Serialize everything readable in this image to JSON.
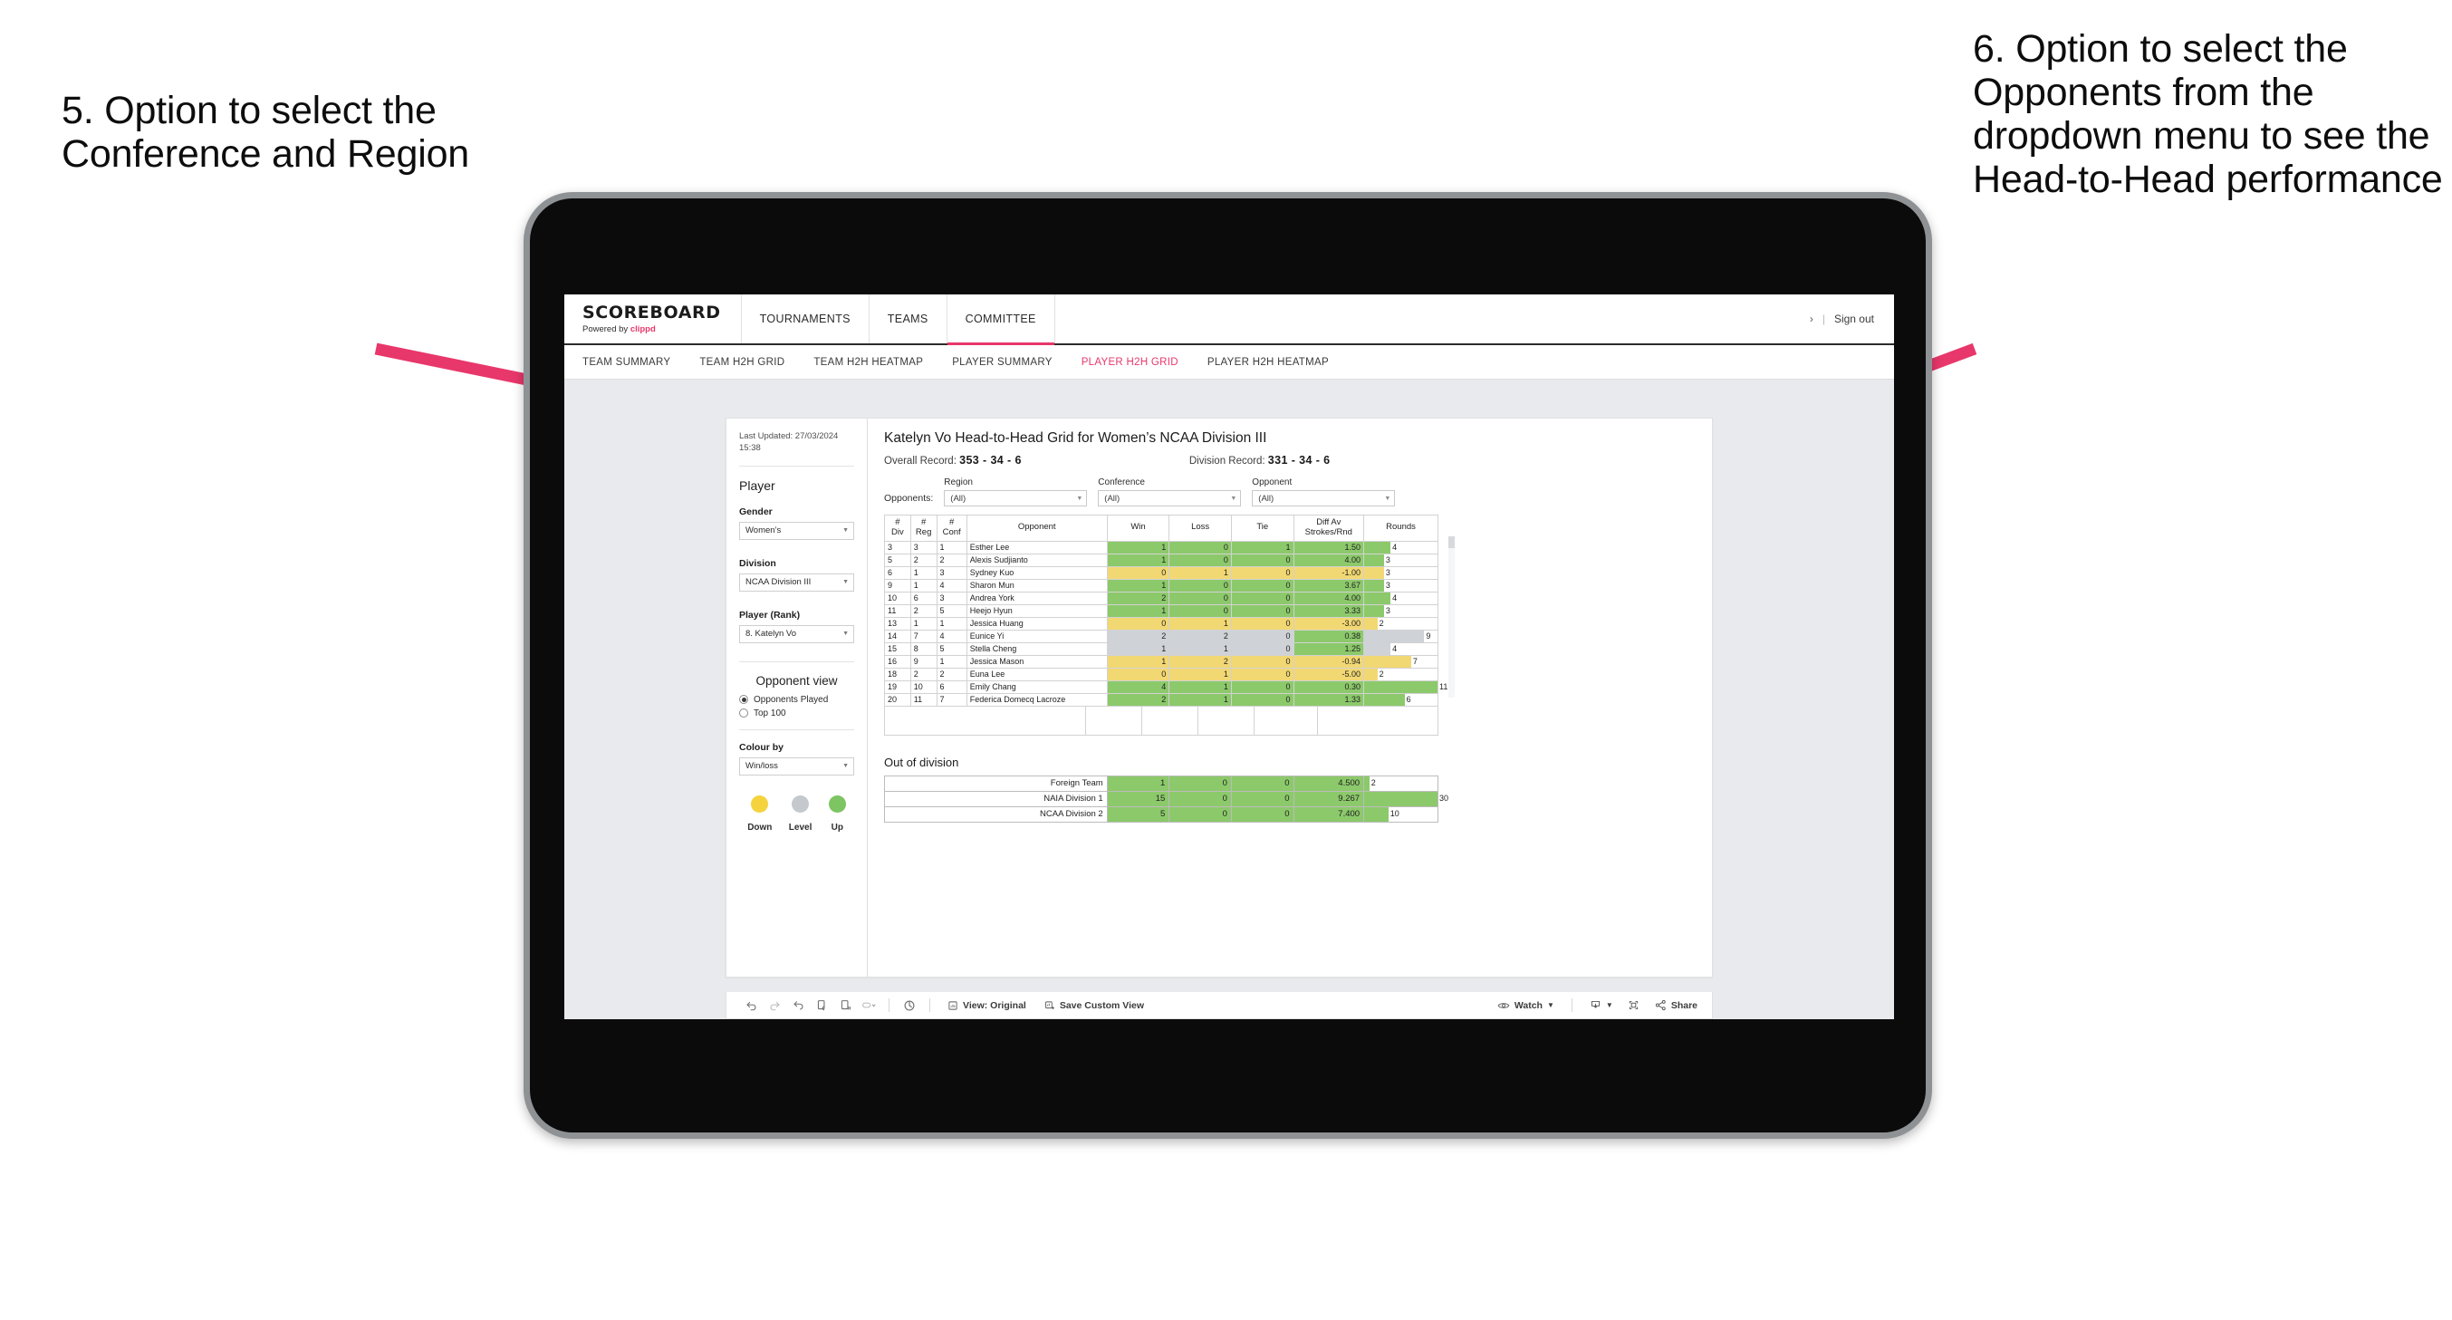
{
  "annotations": {
    "left": "5. Option to select the Conference and Region",
    "right": "6. Option to select the Opponents from the dropdown menu to see the Head-to-Head performance",
    "arrow_color": "#E8376B"
  },
  "app": {
    "brand": {
      "title": "SCOREBOARD",
      "powered_prefix": "Powered by ",
      "powered_brand": "clippd"
    },
    "topnav": [
      {
        "label": "TOURNAMENTS",
        "active": false
      },
      {
        "label": "TEAMS",
        "active": false
      },
      {
        "label": "COMMITTEE",
        "active": true
      }
    ],
    "topbar_right": {
      "chevron": "›",
      "separator": "|",
      "signout": "Sign out"
    },
    "subnav": [
      {
        "label": "TEAM SUMMARY",
        "active": false
      },
      {
        "label": "TEAM H2H GRID",
        "active": false
      },
      {
        "label": "TEAM H2H HEATMAP",
        "active": false
      },
      {
        "label": "PLAYER SUMMARY",
        "active": false
      },
      {
        "label": "PLAYER H2H GRID",
        "active": true
      },
      {
        "label": "PLAYER H2H HEATMAP",
        "active": false
      }
    ]
  },
  "sidebar": {
    "last_updated": "Last Updated: 27/03/2024 15:38",
    "player_heading": "Player",
    "gender": {
      "label": "Gender",
      "value": "Women’s"
    },
    "division": {
      "label": "Division",
      "value": "NCAA Division III"
    },
    "player_rank": {
      "label": "Player (Rank)",
      "value": "8. Katelyn Vo"
    },
    "opponent_view": {
      "heading": "Opponent view",
      "options": [
        {
          "label": "Opponents Played",
          "selected": true
        },
        {
          "label": "Top 100",
          "selected": false
        }
      ]
    },
    "colour_by": {
      "label": "Colour by",
      "value": "Win/loss"
    },
    "legend": [
      {
        "label": "Down",
        "color": "#F5D33F"
      },
      {
        "label": "Level",
        "color": "#C5C9CE"
      },
      {
        "label": "Up",
        "color": "#7DC462"
      }
    ]
  },
  "main": {
    "title": "Katelyn Vo Head-to-Head Grid for Women’s NCAA Division III",
    "overall_record": {
      "label": "Overall Record:",
      "value": "353 -  34 - 6"
    },
    "division_record": {
      "label": "Division Record:",
      "value": "331 -  34 - 6"
    },
    "filters": {
      "prefix": "Opponents:",
      "items": [
        {
          "label": "Region",
          "value": "(All)"
        },
        {
          "label": "Conference",
          "value": "(All)"
        },
        {
          "label": "Opponent",
          "value": "(All)"
        }
      ]
    },
    "table": {
      "headers": [
        "# Div",
        "# Reg",
        "# Conf",
        "Opponent",
        "Win",
        "Loss",
        "Tie",
        "Diff Av Strokes/Rnd",
        "Rounds"
      ],
      "header_lines": [
        [
          "#",
          "Div"
        ],
        [
          "#",
          "Reg"
        ],
        [
          "#",
          "Conf"
        ],
        [
          "Opponent"
        ],
        [
          "Win"
        ],
        [
          "Loss"
        ],
        [
          "Tie"
        ],
        [
          "Diff Av",
          "Strokes/Rnd"
        ],
        [
          "Rounds"
        ]
      ],
      "rounds_max": 11,
      "rows": [
        {
          "div": "3",
          "reg": "3",
          "conf": "1",
          "opponent": "Esther Lee",
          "win": "1",
          "loss": "0",
          "tie": "1",
          "diff": "1.50",
          "rounds": "4",
          "color": "green"
        },
        {
          "div": "5",
          "reg": "2",
          "conf": "2",
          "opponent": "Alexis Sudjianto",
          "win": "1",
          "loss": "0",
          "tie": "0",
          "diff": "4.00",
          "rounds": "3",
          "color": "green"
        },
        {
          "div": "6",
          "reg": "1",
          "conf": "3",
          "opponent": "Sydney Kuo",
          "win": "0",
          "loss": "1",
          "tie": "0",
          "diff": "-1.00",
          "rounds": "3",
          "color": "yellow"
        },
        {
          "div": "9",
          "reg": "1",
          "conf": "4",
          "opponent": "Sharon Mun",
          "win": "1",
          "loss": "0",
          "tie": "0",
          "diff": "3.67",
          "rounds": "3",
          "color": "green"
        },
        {
          "div": "10",
          "reg": "6",
          "conf": "3",
          "opponent": "Andrea York",
          "win": "2",
          "loss": "0",
          "tie": "0",
          "diff": "4.00",
          "rounds": "4",
          "color": "green"
        },
        {
          "div": "11",
          "reg": "2",
          "conf": "5",
          "opponent": "Heejo Hyun",
          "win": "1",
          "loss": "0",
          "tie": "0",
          "diff": "3.33",
          "rounds": "3",
          "color": "green"
        },
        {
          "div": "13",
          "reg": "1",
          "conf": "1",
          "opponent": "Jessica Huang",
          "win": "0",
          "loss": "1",
          "tie": "0",
          "diff": "-3.00",
          "rounds": "2",
          "color": "yellow"
        },
        {
          "div": "14",
          "reg": "7",
          "conf": "4",
          "opponent": "Eunice Yi",
          "win": "2",
          "loss": "2",
          "tie": "0",
          "diff": "0.38",
          "rounds": "9",
          "color": "grey",
          "diff_color": "green"
        },
        {
          "div": "15",
          "reg": "8",
          "conf": "5",
          "opponent": "Stella Cheng",
          "win": "1",
          "loss": "1",
          "tie": "0",
          "diff": "1.25",
          "rounds": "4",
          "color": "grey",
          "diff_color": "green"
        },
        {
          "div": "16",
          "reg": "9",
          "conf": "1",
          "opponent": "Jessica Mason",
          "win": "1",
          "loss": "2",
          "tie": "0",
          "diff": "-0.94",
          "rounds": "7",
          "color": "yellow"
        },
        {
          "div": "18",
          "reg": "2",
          "conf": "2",
          "opponent": "Euna Lee",
          "win": "0",
          "loss": "1",
          "tie": "0",
          "diff": "-5.00",
          "rounds": "2",
          "color": "yellow"
        },
        {
          "div": "19",
          "reg": "10",
          "conf": "6",
          "opponent": "Emily Chang",
          "win": "4",
          "loss": "1",
          "tie": "0",
          "diff": "0.30",
          "rounds": "11",
          "color": "green"
        },
        {
          "div": "20",
          "reg": "11",
          "conf": "7",
          "opponent": "Federica Domecq Lacroze",
          "win": "2",
          "loss": "1",
          "tie": "0",
          "diff": "1.33",
          "rounds": "6",
          "color": "green"
        }
      ]
    },
    "out_of_division": {
      "title": "Out of division",
      "rounds_max": 30,
      "rows": [
        {
          "name": "Foreign Team",
          "win": "1",
          "loss": "0",
          "tie": "0",
          "diff": "4.500",
          "rounds": "2",
          "color": "green"
        },
        {
          "name": "NAIA Division 1",
          "win": "15",
          "loss": "0",
          "tie": "0",
          "diff": "9.267",
          "rounds": "30",
          "color": "green"
        },
        {
          "name": "NCAA Division 2",
          "win": "5",
          "loss": "0",
          "tie": "0",
          "diff": "7.400",
          "rounds": "10",
          "color": "green"
        }
      ]
    }
  },
  "toolbar": {
    "icons": [
      "undo-icon",
      "redo-icon",
      "revert-icon",
      "refresh-icon",
      "pause-icon",
      "back-icon"
    ],
    "view_label": "View: Original",
    "save_custom_view_label": "Save Custom View",
    "watch_label": "Watch",
    "share_label": "Share"
  },
  "colors": {
    "green": "#8CC96B",
    "yellow": "#F2D873",
    "grey": "#CFD2D6",
    "accent": "#E8376B"
  }
}
